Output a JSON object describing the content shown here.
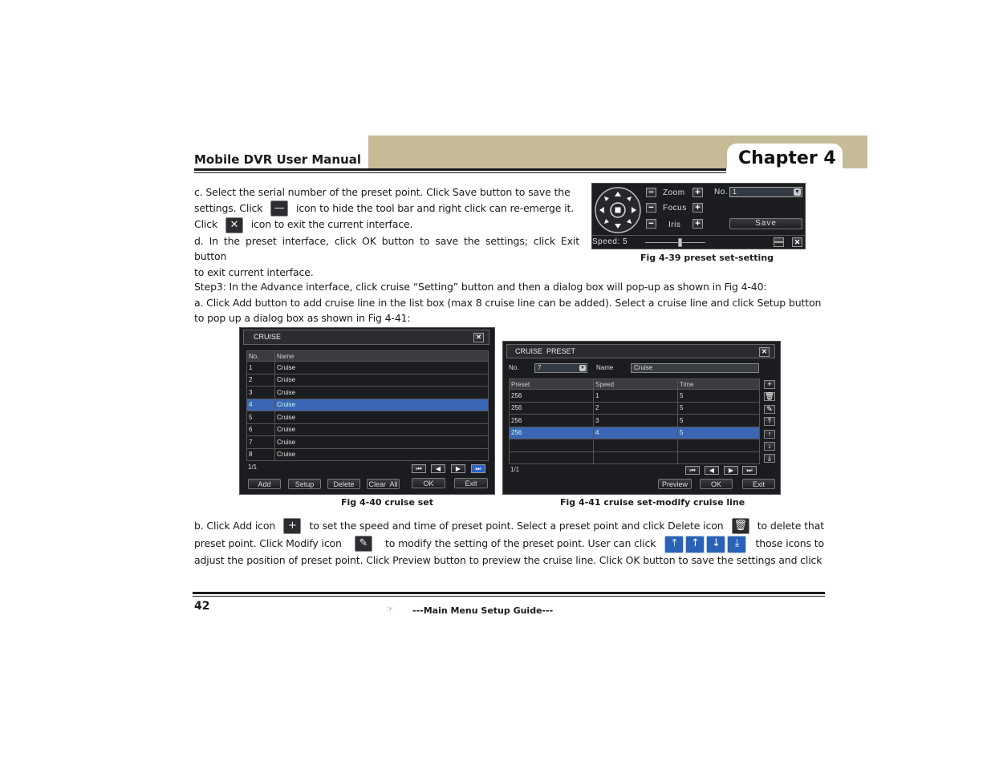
{
  "header": {
    "manual_title": "Mobile DVR User Manual",
    "chapter": "Chapter 4",
    "band_color": "#c5bb97"
  },
  "section_c_d": {
    "c_line1": "c. Select the serial number of the preset point. Click Save button to save the",
    "c_line2_pre": "settings. Click",
    "c_line2_post": "icon to hide the tool bar and right click can re-emerge it.",
    "c_line3_pre": "Click",
    "c_line3_post": "icon to exit the current interface.",
    "d_line1": "d. In the preset interface, click OK button to save the settings; click Exit button",
    "d_line2": "to exit current interface.",
    "hide_icon_glyph": "—",
    "close_icon_glyph": "✕"
  },
  "fig39": {
    "caption": "Fig 4-39 preset set-setting",
    "zoom_label": "Zoom",
    "focus_label": "Focus",
    "iris_label": "Iris",
    "minus_glyph": "−",
    "plus_glyph": "+",
    "no_label": "No.",
    "no_value": "1",
    "save_label": "Save",
    "speed_label": "Speed: 5",
    "speed_value": 5,
    "speed_fraction": 0.55,
    "hide_glyph": "—",
    "close_glyph": "✕"
  },
  "step3": {
    "line1": "Step3: In the Advance interface, click cruise “Setting” button and then a dialog box will pop-up as shown in Fig 4-40:",
    "line2": "a. Click Add button to add cruise line in the list box (max 8 cruise line can be added). Select a cruise line and click Setup button",
    "line3": "to pop up a dialog box as shown in Fig 4-41:"
  },
  "fig40": {
    "caption": "Fig 4-40 cruise set",
    "title": "CRUISE",
    "close_glyph": "✕",
    "columns": [
      "No.",
      "Name"
    ],
    "rows": [
      [
        "1",
        "Cruise"
      ],
      [
        "2",
        "Cruise"
      ],
      [
        "3",
        "Cruise"
      ],
      [
        "4",
        "Cruise"
      ],
      [
        "5",
        "Cruise"
      ],
      [
        "6",
        "Cruise"
      ],
      [
        "7",
        "Cruise"
      ],
      [
        "8",
        "Cruise"
      ]
    ],
    "selected_row": 3,
    "page": "1/1",
    "nav": [
      "⏮",
      "◀",
      "▶",
      "⏭"
    ],
    "buttons": {
      "add": "Add",
      "setup": "Setup",
      "delete": "Delete",
      "clear_all": "Clear  All",
      "ok": "OK",
      "exit": "Exit"
    }
  },
  "fig41": {
    "caption": "Fig 4-41 cruise set-modify cruise line",
    "title": "CRUISE  PRESET",
    "close_glyph": "✕",
    "no_label": "No.",
    "no_value": "7",
    "name_label": "Name",
    "name_value": "Cruise",
    "columns": [
      "Preset",
      "Speed",
      "Time"
    ],
    "rows": [
      [
        "256",
        "1",
        "5"
      ],
      [
        "256",
        "2",
        "5"
      ],
      [
        "256",
        "3",
        "5"
      ],
      [
        "256",
        "4",
        "5"
      ],
      [
        "",
        "",
        ""
      ],
      [
        "",
        "",
        ""
      ]
    ],
    "selected_row": 3,
    "page": "1/1",
    "nav": [
      "⏮",
      "◀",
      "▶",
      "⏭"
    ],
    "side_icons": [
      "+",
      "🗑",
      "✎",
      "⤒",
      "↑",
      "↓",
      "⤓"
    ],
    "buttons": {
      "preview": "Preview",
      "ok": "OK",
      "exit": "Exit"
    }
  },
  "section_b": {
    "line1_a": "b. Click Add icon",
    "line1_b": "to set the speed and time of preset point. Select a preset point and click Delete icon",
    "line1_c": "to delete that",
    "line2_a": "preset point. Click Modify icon",
    "line2_b": "to modify the setting of the preset point. User can click",
    "line2_c": "those icons to",
    "line3": "adjust the position of preset point. Click Preview button to preview the cruise line. Click OK button to save the settings and click",
    "add_glyph": "+",
    "delete_glyph": "🗑",
    "modify_glyph": "✎",
    "move_glyphs": [
      "⤒",
      "↑",
      "↓",
      "⤓"
    ]
  },
  "footer": {
    "page_number": "42",
    "hand_glyph": "☞",
    "guide_title": "---Main Menu Setup Guide---"
  }
}
